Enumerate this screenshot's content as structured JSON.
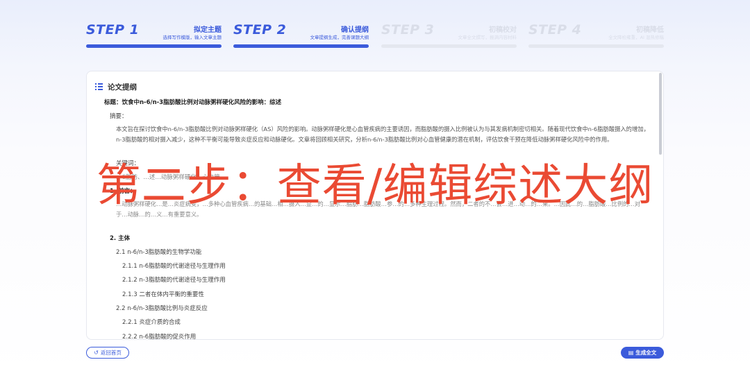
{
  "steps": [
    {
      "num": "STEP 1",
      "title": "拟定主题",
      "desc": "选择写作模版，输入文章主题"
    },
    {
      "num": "STEP 2",
      "title": "确认提纲",
      "desc": "文章提纲生成，完善课题大纲"
    },
    {
      "num": "STEP 3",
      "title": "初稿校对",
      "desc": "文章全文撰写，报满内容材料"
    },
    {
      "num": "STEP 4",
      "title": "初稿降低",
      "desc": "全文降检雍重，AI 混热修稿"
    }
  ],
  "outline": {
    "header": "论文提纲",
    "title_line": "标题：饮食中n-6/n-3脂肪酸比例对动脉粥样硬化风险的影响：综述",
    "abstract_label": "摘要：",
    "abstract_text": "本文旨在探讨饮食中n-6/n-3脂肪酸比例对动脉粥样硬化（AS）风险的影响。动脉粥样硬化是心血管疾病的主要诱因，而脂肪酸的摄入比例被认为与其发病机制密切相关。随着现代饮食中n-6脂肪酸摄入的增加，n-3脂肪酸的相对摄入减少，这种不平衡可能导致炎症反应和动脉硬化。文章将回顾相关研究，分析n-6/n-3脂肪酸比例对心血管健康的潜在机制，评估饮食干预在降低动脉粥样硬化风险中的作用。",
    "keywords_label": "关键词：",
    "keywords_partial": "n-6脂肪、…述…动脉粥样硬化，心血管…",
    "sec1": "1. 前言：",
    "sec1_text": "…动脉粥样硬化…是…炎症病变，…多种心血管疾病…的基础…相…摄入…显…的…显示…脂肪…脂肪酸…参…的…多种生理过程。然而，二者的不…会…进…动…的…果。…因此…的…脂肪酸…比例的…对于…动脉…的…义…有重要意义。",
    "sec2": "2. 主体",
    "items": [
      "2.1 n-6/n-3脂肪酸的生物学功能",
      "2.1.1 n-6脂肪酸的代谢途径与生理作用",
      "2.1.2 n-3脂肪酸的代谢途径与生理作用",
      "2.1.3 二者在体内平衡的重要性",
      "2.2 n-6/n-3脂肪酸比例与炎症反应",
      "2.2.1 炎症介质的合成",
      "2.2.2 n-6脂肪酸的促炎作用"
    ]
  },
  "buttons": {
    "back": "返回首页",
    "generate": "生成全文"
  },
  "overlay_text": "第二步：查看/编辑综述大纲",
  "colors": {
    "accent": "#3b5bdb",
    "overlay": "#ea4a33"
  }
}
